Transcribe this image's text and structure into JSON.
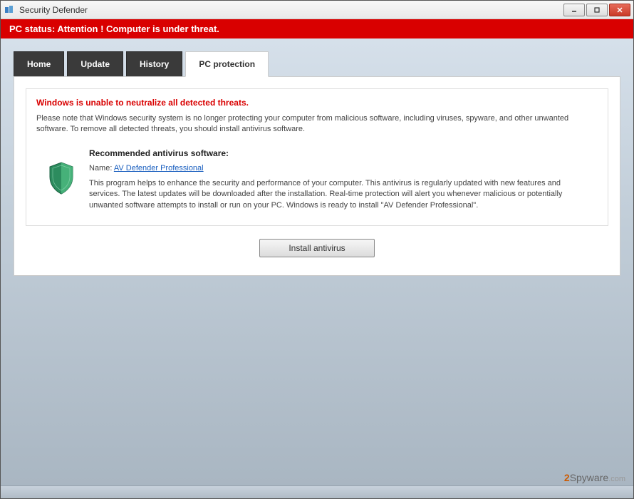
{
  "window": {
    "title": "Security Defender"
  },
  "status": {
    "text": "PC status: Attention ! Computer is under threat."
  },
  "tabs": [
    {
      "label": "Home"
    },
    {
      "label": "Update"
    },
    {
      "label": "History"
    },
    {
      "label": "PC protection",
      "active": true
    }
  ],
  "panel": {
    "alert_heading": "Windows is unable to neutralize all detected threats.",
    "body_text": "Please note that Windows security system is no longer protecting your computer from malicious software, including viruses, spyware, and other unwanted software. To remove all detected threats, you should install antivirus software.",
    "recommend": {
      "title": "Recommended antivirus software:",
      "name_label": "Name: ",
      "name_link": "AV Defender Professional",
      "description": "This program helps to enhance the security and performance of your computer. This antivirus is regularly updated with new features and services. The latest updates will be downloaded after the installation. Real-time protection will alert you whenever malicious or potentially unwanted software attempts to install or run on your PC. Windows is ready to install \"AV Defender Professional\"."
    },
    "install_label": "Install antivirus"
  },
  "watermark": {
    "prefix": "2",
    "main": "Spyware",
    "suffix": ".com"
  }
}
